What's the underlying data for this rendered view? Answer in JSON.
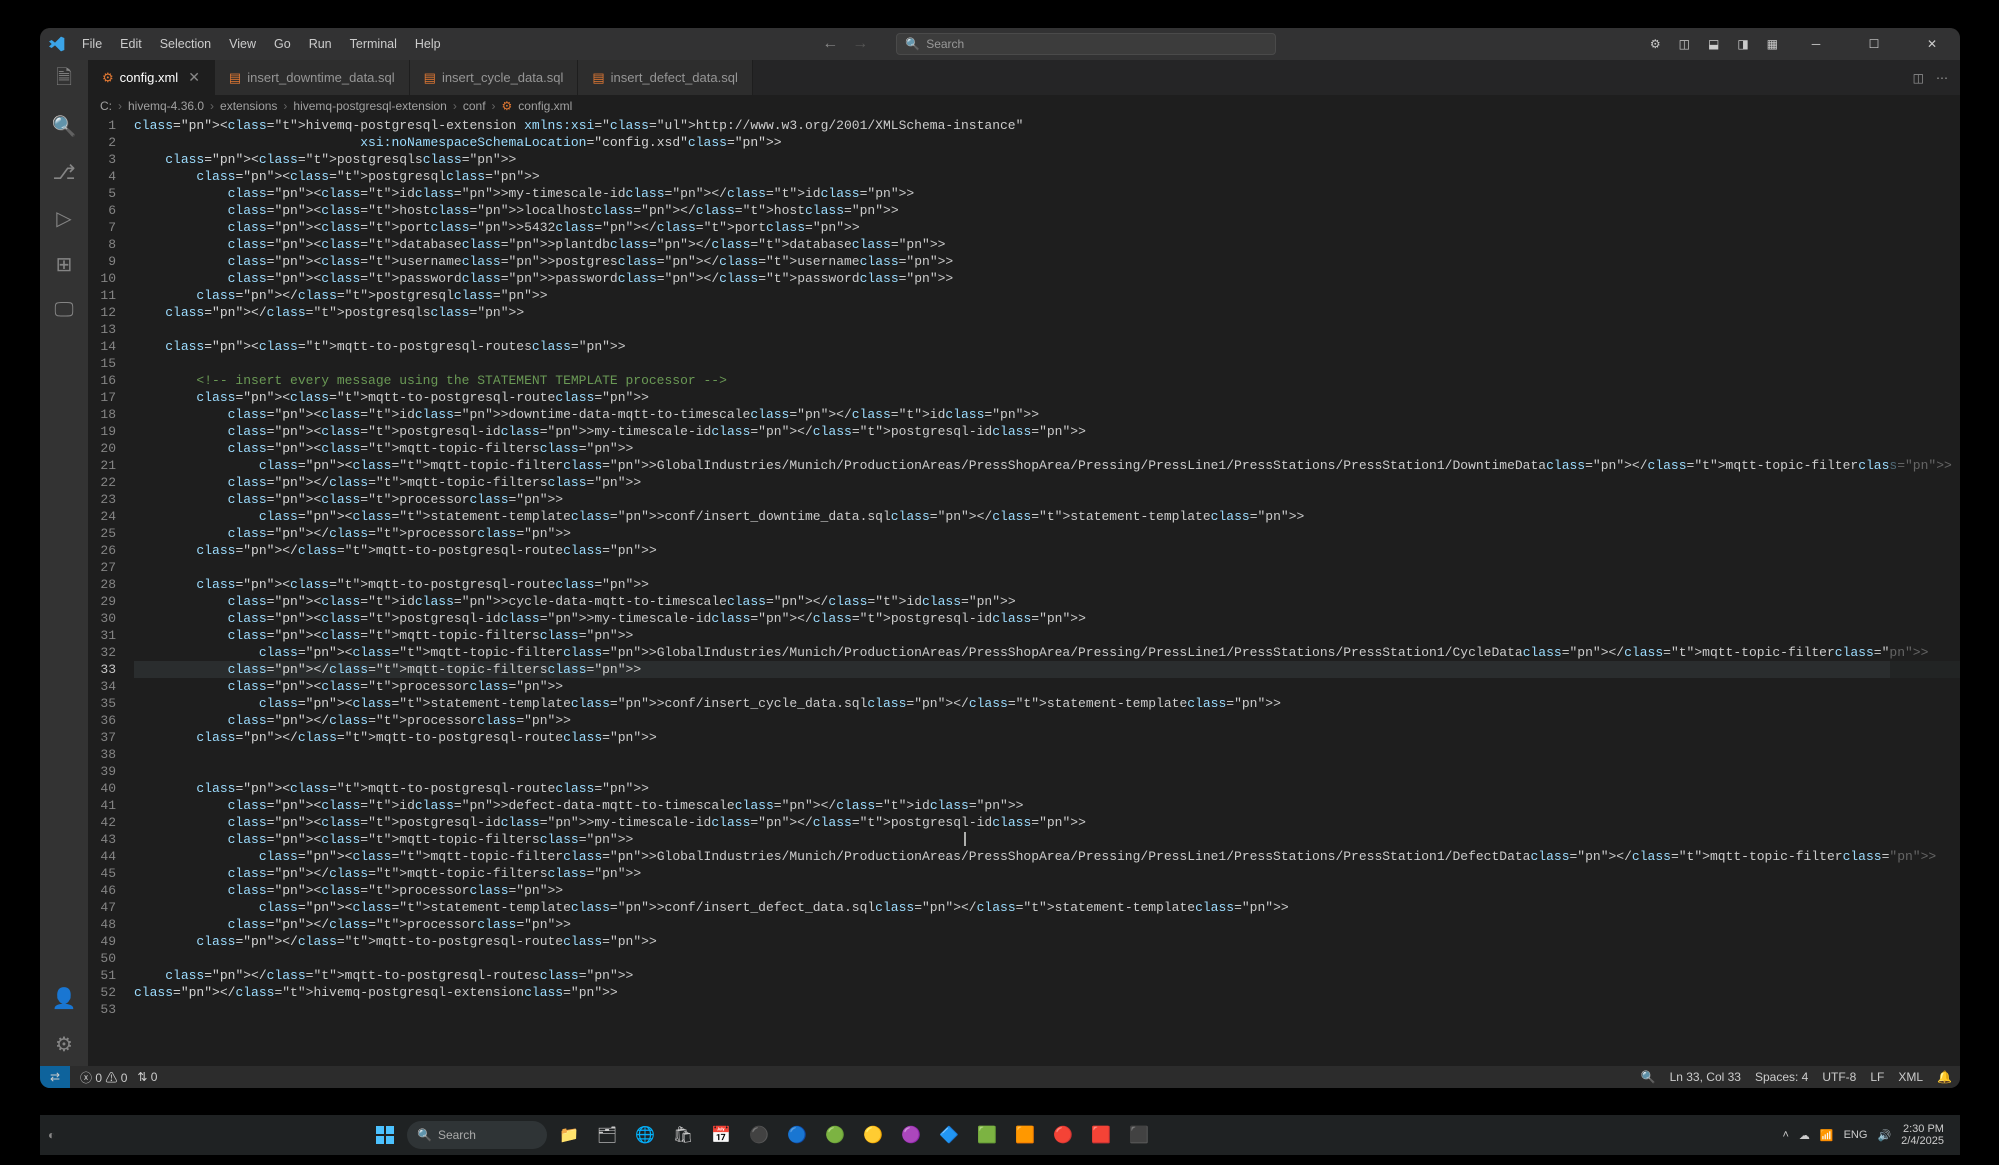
{
  "menubar": [
    "File",
    "Edit",
    "Selection",
    "View",
    "Go",
    "Run",
    "Terminal",
    "Help"
  ],
  "search_placeholder": "Search",
  "tabs": [
    {
      "name": "config.xml",
      "active": true,
      "close": true
    },
    {
      "name": "insert_downtime_data.sql",
      "active": false,
      "close": false
    },
    {
      "name": "insert_cycle_data.sql",
      "active": false,
      "close": false
    },
    {
      "name": "insert_defect_data.sql",
      "active": false,
      "close": false
    }
  ],
  "breadcrumb": [
    "C:",
    "hivemq-4.36.0",
    "extensions",
    "hivemq-postgresql-extension",
    "conf",
    "config.xml"
  ],
  "breadcrumb_icon": "⚙",
  "code": {
    "1": "<hivemq-postgresql-extension xmlns:xsi=\"http://www.w3.org/2001/XMLSchema-instance\"",
    "2": "                             xsi:noNamespaceSchemaLocation=\"config.xsd\">",
    "3": "    <postgresqls>",
    "4": "        <postgresql>",
    "5": "            <id>my-timescale-id</id>",
    "6": "            <host>localhost</host>",
    "7": "            <port>5432</port>",
    "8": "            <database>plantdb</database>",
    "9": "            <username>postgres</username>",
    "10": "            <password>password</password>",
    "11": "        </postgresql>",
    "12": "    </postgresqls>",
    "14": "    <mqtt-to-postgresql-routes>",
    "16": "        <!-- insert every message using the STATEMENT TEMPLATE processor -->",
    "17": "        <mqtt-to-postgresql-route>",
    "18": "            <id>downtime-data-mqtt-to-timescale</id>",
    "19": "            <postgresql-id>my-timescale-id</postgresql-id>",
    "20": "            <mqtt-topic-filters>",
    "21": "                <mqtt-topic-filter>GlobalIndustries/Munich/ProductionAreas/PressShopArea/Pressing/PressLine1/PressStations/PressStation1/DowntimeData</mqtt-topic-filter>",
    "22": "            </mqtt-topic-filters>",
    "23": "            <processor>",
    "24": "                <statement-template>conf/insert_downtime_data.sql</statement-template>",
    "25": "            </processor>",
    "26": "        </mqtt-to-postgresql-route>",
    "28": "        <mqtt-to-postgresql-route>",
    "29": "            <id>cycle-data-mqtt-to-timescale</id>",
    "30": "            <postgresql-id>my-timescale-id</postgresql-id>",
    "31": "            <mqtt-topic-filters>",
    "32": "                <mqtt-topic-filter>GlobalIndustries/Munich/ProductionAreas/PressShopArea/Pressing/PressLine1/PressStations/PressStation1/CycleData</mqtt-topic-filter>",
    "33": "            </mqtt-topic-filters>",
    "34": "            <processor>",
    "35": "                <statement-template>conf/insert_cycle_data.sql</statement-template>",
    "36": "            </processor>",
    "37": "        </mqtt-to-postgresql-route>",
    "40": "        <mqtt-to-postgresql-route>",
    "41": "            <id>defect-data-mqtt-to-timescale</id>",
    "42": "            <postgresql-id>my-timescale-id</postgresql-id>",
    "43": "            <mqtt-topic-filters>",
    "44": "                <mqtt-topic-filter>GlobalIndustries/Munich/ProductionAreas/PressShopArea/Pressing/PressLine1/PressStations/PressStation1/DefectData</mqtt-topic-filter>",
    "45": "            </mqtt-topic-filters>",
    "46": "            <processor>",
    "47": "                <statement-template>conf/insert_defect_data.sql</statement-template>",
    "48": "            </processor>",
    "49": "        </mqtt-to-postgresql-route>",
    "51": "    </mqtt-to-postgresql-routes>",
    "52": "</hivemq-postgresql-extension>"
  },
  "active_line": 33,
  "statusbar": {
    "errors": "0",
    "warnings": "0",
    "ports": "0",
    "ln_col": "Ln 33, Col 33",
    "spaces": "Spaces: 4",
    "encoding": "UTF-8",
    "eol": "LF",
    "lang": "XML"
  },
  "taskbar_search": "Search",
  "tray": {
    "lang": "ENG",
    "time": "2:30 PM",
    "date": "2/4/2025"
  }
}
